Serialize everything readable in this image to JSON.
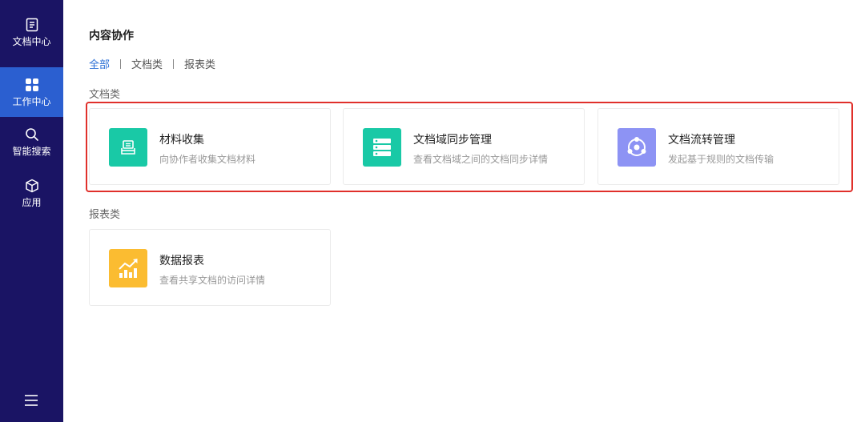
{
  "sidebar": {
    "items": [
      {
        "label": "文档中心",
        "icon": "document-icon",
        "active": false
      },
      {
        "label": "工作中心",
        "icon": "grid-icon",
        "active": true
      },
      {
        "label": "智能搜索",
        "icon": "search-icon",
        "active": false
      },
      {
        "label": "应用",
        "icon": "cube-icon",
        "active": false
      }
    ],
    "menu_icon": "hamburger-menu-icon"
  },
  "main": {
    "title": "内容协作",
    "filters": [
      {
        "label": "全部",
        "active": true
      },
      {
        "label": "文档类",
        "active": false
      },
      {
        "label": "报表类",
        "active": false
      }
    ],
    "sections": [
      {
        "title": "文档类",
        "cards": [
          {
            "title": "材料收集",
            "desc": "向协作者收集文档材料",
            "icon": "collect-tray-icon",
            "color": "#19c9a6"
          },
          {
            "title": "文档域同步管理",
            "desc": "查看文档域之间的文档同步详情",
            "icon": "server-sync-icon",
            "color": "#19c9a6"
          },
          {
            "title": "文档流转管理",
            "desc": "发起基于规则的文档传输",
            "icon": "flow-circle-icon",
            "color": "#8d93f4"
          }
        ]
      },
      {
        "title": "报表类",
        "cards": [
          {
            "title": "数据报表",
            "desc": "查看共享文档的访问详情",
            "icon": "chart-trend-icon",
            "color": "#fbbc31"
          }
        ]
      }
    ]
  },
  "colors": {
    "sidebar_bg": "#1a1464",
    "sidebar_active": "#2b5fd0",
    "accent": "#2b6fd6",
    "highlight": "#e0302b"
  }
}
